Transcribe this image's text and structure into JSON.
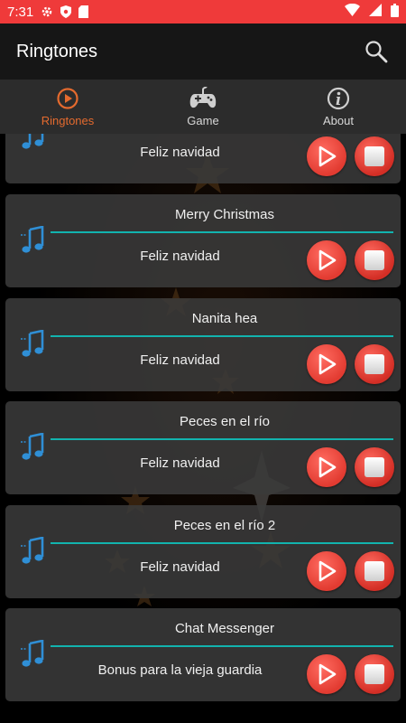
{
  "status_bar": {
    "time": "7:31",
    "icons": [
      "gear-icon",
      "shield-icon",
      "sd-card-icon",
      "wifi-icon",
      "signal-icon",
      "battery-icon"
    ]
  },
  "app_bar": {
    "title": "Ringtones",
    "search_icon": "search-icon"
  },
  "tabs": [
    {
      "label": "Ringtones",
      "icon": "play-circle-icon",
      "active": true
    },
    {
      "label": "Game",
      "icon": "gamepad-icon",
      "active": false
    },
    {
      "label": "About",
      "icon": "info-icon",
      "active": false
    }
  ],
  "colors": {
    "status_bar": "#ef3a3a",
    "accent": "#e46a2e",
    "progress": "#12b3ae",
    "button": "#e23b31"
  },
  "ringtones": [
    {
      "title": "",
      "subtitle": "Feliz navidad"
    },
    {
      "title": "Merry Christmas",
      "subtitle": "Feliz navidad"
    },
    {
      "title": "Nanita hea",
      "subtitle": "Feliz navidad"
    },
    {
      "title": "Peces en el río",
      "subtitle": "Feliz navidad"
    },
    {
      "title": "Peces en el río 2",
      "subtitle": "Feliz navidad"
    },
    {
      "title": "Chat Messenger",
      "subtitle": "Bonus para la vieja guardia"
    }
  ]
}
